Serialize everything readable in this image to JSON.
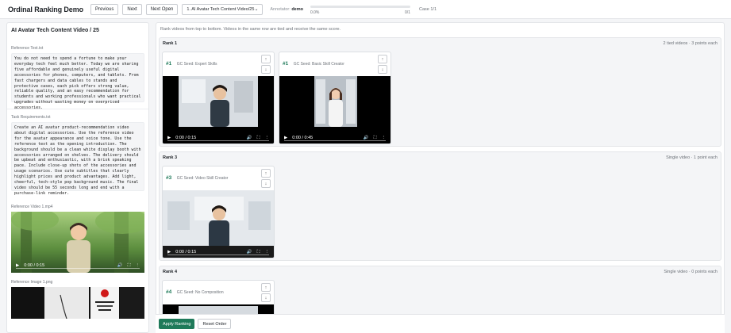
{
  "header": {
    "app_title": "Ordinal Ranking Demo",
    "prev_label": "Previous",
    "next_label": "Next",
    "next_open_label": "Next Open",
    "case_select": "1. AI Avatar Tech Content Video/25",
    "annotator_label": "Annotator:",
    "annotator_name": "demo",
    "progress_percent": "0.0%",
    "progress_fraction": 0,
    "progress_count": "0/1",
    "case_label": "Case 1/1"
  },
  "left": {
    "title": "AI Avatar Tech Content Video / 25",
    "reference_text_label": "Reference Text.txt",
    "reference_text": "You do not need to spend a fortune to make your everyday tech feel much better. Today we are sharing five affordable and genuinely useful digital accessories for phones, computers, and tablets. From fast chargers and data cables to stands and protective cases, each pick offers strong value, reliable quality, and an easy recommendation for students and working professionals who want practical upgrades without wasting money on overpriced accessories.",
    "task_label": "Task Requirements.txt",
    "task_text": "Create an AI avatar product-recommendation video about digital accessories. Use the reference video for the avatar appearance and voice tone. Use the reference text as the opening introduction. The background should be a clean white display booth with accessories arranged on shelves. The delivery should be upbeat and enthusiastic, with a brisk speaking pace. Include close-up shots of the accessories and usage scenarios. Use cute subtitles that clearly highlight prices and product advantages. Add light, cheerful, tech-style pop background music. The final video should be 55 seconds long and end with a purchase-link reminder.",
    "ref_video_label": "Reference Video 1.mp4",
    "ref_video_time": "0:00 / 0:15",
    "ref_image_label": "Reference Image 1.png"
  },
  "main": {
    "instructions": "Rank videos from top to bottom. Videos in the same row are tied and receive the same score.",
    "ranks": [
      {
        "title": "Rank 1",
        "meta": "2 tied videos · 3 points each",
        "cards": [
          {
            "num": "#1",
            "label": "GC Seed: Expert Skills",
            "time": "0:00 / 0:15"
          },
          {
            "num": "#1",
            "label": "GC Seed: Basic Skill Creator",
            "time": "0:00 / 0:45"
          }
        ]
      },
      {
        "title": "Rank 3",
        "meta": "Single video · 1 point each",
        "cards": [
          {
            "num": "#3",
            "label": "GC Seed: Video Skill Creator",
            "time": "0:00 / 0:15"
          }
        ]
      },
      {
        "title": "Rank 4",
        "meta": "Single video · 0 points each",
        "cards": [
          {
            "num": "#4",
            "label": "GC Seed: No Composition",
            "time": ""
          }
        ]
      }
    ],
    "up_arrow": "↑",
    "down_arrow": "↓"
  },
  "footer": {
    "apply_label": "Apply Ranking",
    "reset_label": "Reset Order"
  },
  "colors": {
    "accent": "#1f7a5a",
    "video_bg": "#000000"
  }
}
